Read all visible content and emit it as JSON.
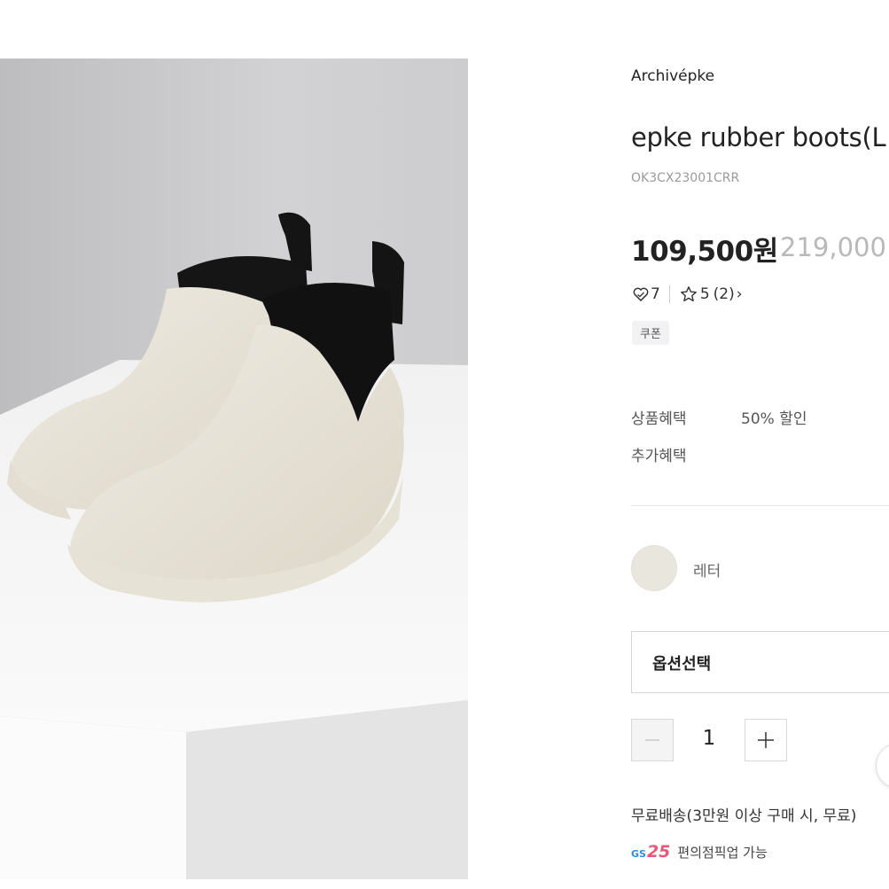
{
  "product": {
    "brand": "Archivépke",
    "title": "epke rubber boots(L",
    "code": "OK3CX23001CRR",
    "price": "109,500원",
    "original_price": "219,000",
    "likes": "7",
    "rating": "5",
    "review_count": "(2)",
    "coupon_label": "쿠폰"
  },
  "benefits": {
    "product_benefit_label": "상품혜택",
    "product_benefit_value": "50% 할인",
    "extra_benefit_label": "추가혜택"
  },
  "option": {
    "color_name": "레터",
    "color_swatch": "#e9e6de",
    "select_placeholder": "옵션선택"
  },
  "quantity": {
    "value": "1"
  },
  "shipping": {
    "text": "무료배송(3만원 이상 구매 시, 무료)",
    "pickup_logo_prefix": "GS",
    "pickup_logo_number": "25",
    "pickup_text": "편의점픽업 가능"
  },
  "colors": {
    "text_primary": "#222222",
    "text_muted": "#9a9a9a",
    "strike_price": "#b8b8b8",
    "gs_blue": "#2b8fd6",
    "gs_pink": "#e8577a"
  }
}
